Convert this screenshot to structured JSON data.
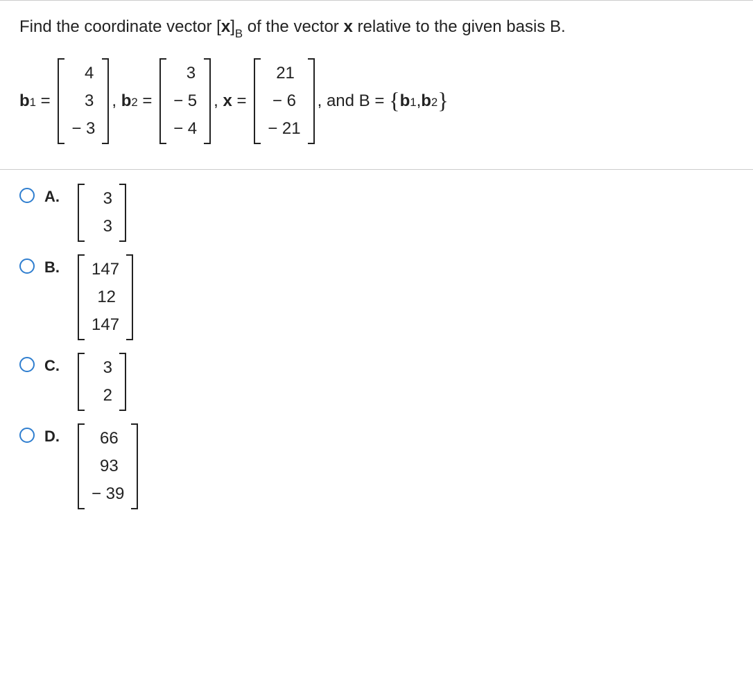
{
  "question_prefix": "Find the coordinate vector [",
  "question_x": "x",
  "question_bracket_close": "]",
  "question_sub": "B",
  "question_suffix": " of the vector ",
  "question_x2": "x",
  "question_rest": " relative to the given basis B.",
  "eq": {
    "b1_label": "b",
    "b1_sub": "1",
    "equals": " = ",
    "b1_col": [
      "4",
      "3",
      "− 3"
    ],
    "comma1": ", ",
    "b2_label": "b",
    "b2_sub": "2",
    "b2_col": [
      "3",
      "− 5",
      "− 4"
    ],
    "comma2": ", ",
    "x_label": "x",
    "x_col": [
      "21",
      "− 6",
      "− 21"
    ],
    "and_text": ", and B = ",
    "lbrace": "{",
    "set_b1": "b",
    "set_b1s": "1",
    "set_comma": ",",
    "set_b2": "b",
    "set_b2s": "2",
    "rbrace": "}"
  },
  "options": {
    "A": {
      "label": "A.",
      "values": [
        "3",
        "3"
      ]
    },
    "B": {
      "label": "B.",
      "values": [
        "147",
        "12",
        "147"
      ]
    },
    "C": {
      "label": "C.",
      "values": [
        "3",
        "2"
      ]
    },
    "D": {
      "label": "D.",
      "values": [
        "66",
        "93",
        "− 39"
      ]
    }
  }
}
